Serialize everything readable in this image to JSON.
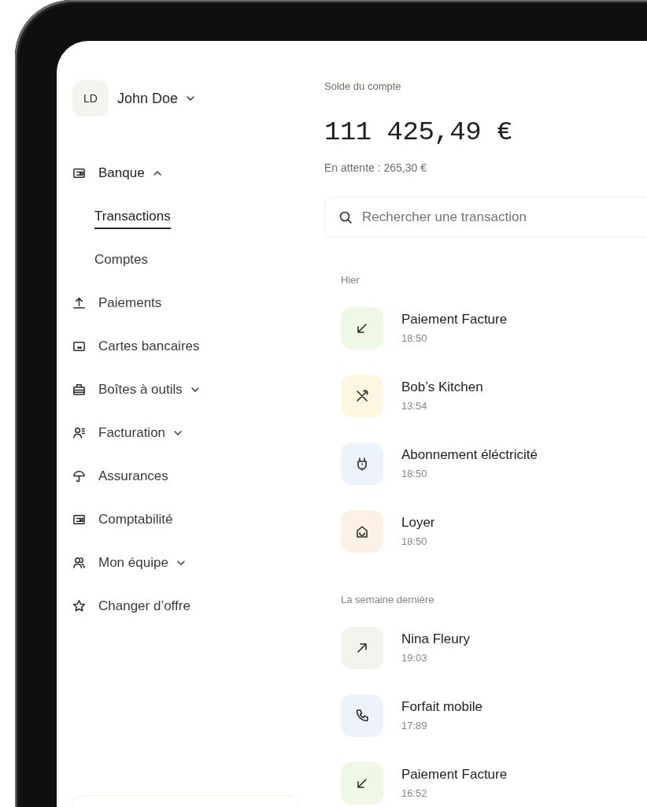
{
  "sidebar": {
    "user": {
      "initials": "LD",
      "name": "John Doe",
      "expanded": false
    },
    "items": [
      {
        "kind": "group",
        "label": "Banque",
        "expanded": true,
        "selected": false,
        "children": [
          {
            "label": "Transactions",
            "selected": true
          },
          {
            "label": "Comptes",
            "selected": false
          }
        ]
      },
      {
        "kind": "link",
        "label": "Paiements",
        "selected": false
      },
      {
        "kind": "link",
        "label": "Cartes bancaires",
        "selected": false
      },
      {
        "kind": "group",
        "label": "Boîtes à outils",
        "expanded": false,
        "selected": false
      },
      {
        "kind": "group",
        "label": "Facturation",
        "expanded": false,
        "selected": false
      },
      {
        "kind": "link",
        "label": "Assurances",
        "selected": false
      },
      {
        "kind": "link",
        "label": "Comptabilité",
        "selected": false
      },
      {
        "kind": "group",
        "label": "Mon équipe",
        "expanded": false,
        "selected": false
      },
      {
        "kind": "link",
        "label": "Changer d’offre",
        "selected": false
      }
    ]
  },
  "account": {
    "label": "Solde du compte",
    "balance": "111 425,49 €",
    "pending": "En attente : 265,30 €"
  },
  "search": {
    "placeholder": "Rechercher une transaction"
  },
  "sections": [
    {
      "title": "Hier",
      "transactions": [
        {
          "kind": "incoming",
          "color": "#eef8e5",
          "title": "Paiement Facture",
          "time": "18:50"
        },
        {
          "kind": "restaurant",
          "color": "#fdf7df",
          "title": "Bob’s Kitchen",
          "time": "13:54"
        },
        {
          "kind": "utility",
          "color": "#edf3fb",
          "title": "Abonnement éléctricité",
          "time": "18:50"
        },
        {
          "kind": "rent",
          "color": "#fdf0e5",
          "title": "Loyer",
          "time": "18:50"
        }
      ]
    },
    {
      "title": "La semaine dernière",
      "transactions": [
        {
          "kind": "outgoing",
          "color": "#f4f3ee",
          "title": "Nina Fleury",
          "time": "19:03"
        },
        {
          "kind": "phone",
          "color": "#edf3fb",
          "title": "Forfait mobile",
          "time": "17:89"
        },
        {
          "kind": "incoming",
          "color": "#eef8e5",
          "title": "Paiement Facture",
          "time": "16:52"
        }
      ]
    }
  ]
}
